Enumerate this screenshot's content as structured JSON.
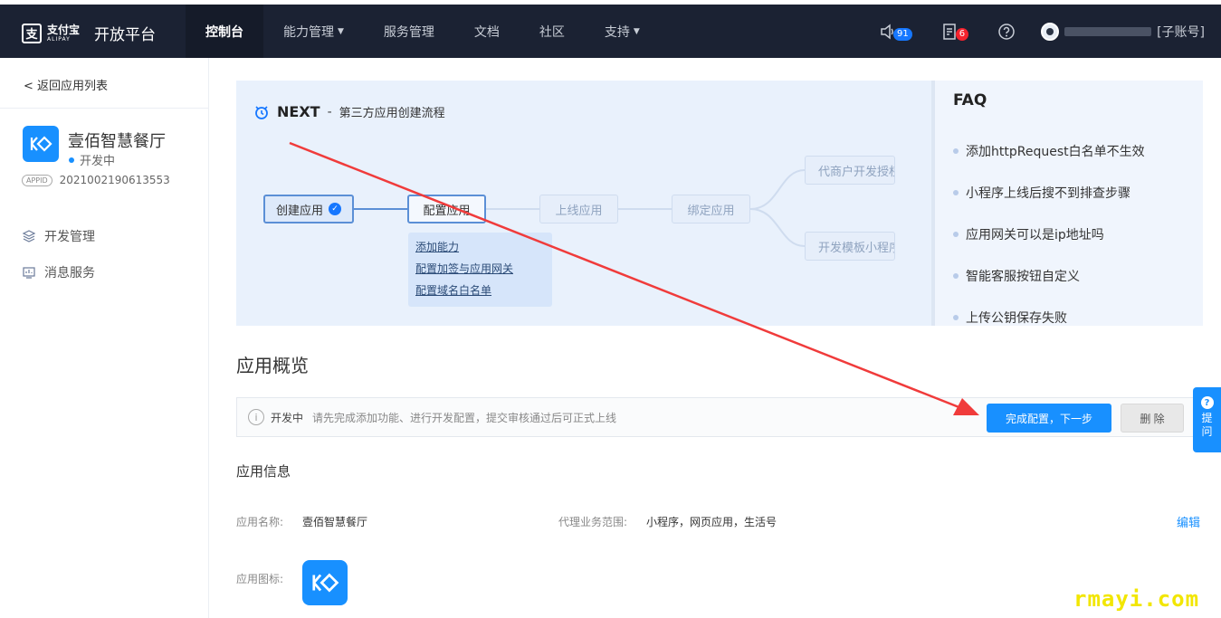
{
  "brand": {
    "logo_cn": "支付宝",
    "logo_en": "ALIPAY",
    "platform": "开放平台"
  },
  "nav": [
    {
      "label": "控制台",
      "active": true,
      "dropdown": false
    },
    {
      "label": "能力管理",
      "active": false,
      "dropdown": true
    },
    {
      "label": "服务管理",
      "active": false,
      "dropdown": false
    },
    {
      "label": "文档",
      "active": false,
      "dropdown": false
    },
    {
      "label": "社区",
      "active": false,
      "dropdown": false
    },
    {
      "label": "支持",
      "active": false,
      "dropdown": true
    }
  ],
  "tools": {
    "notify_count": "91",
    "task_count": "6",
    "user_suffix": "[子账号]"
  },
  "sidebar": {
    "back": "返回应用列表",
    "app_name": "壹佰智慧餐厅",
    "status": "开发中",
    "appid_tag": "APPID",
    "appid": "2021002190613553",
    "menu": [
      "开发管理",
      "消息服务"
    ]
  },
  "flow": {
    "next": "NEXT",
    "sep": "-",
    "subtitle": "第三方应用创建流程",
    "nodes": {
      "create": "创建应用",
      "config": "配置应用",
      "online": "上线应用",
      "bind": "绑定应用",
      "merchant": "代商户开发授权",
      "template": "开发模板小程序"
    },
    "sub_links": [
      "添加能力",
      "配置加签与应用网关",
      "配置域名白名单"
    ]
  },
  "faq": {
    "title": "FAQ",
    "items": [
      "添加httpRequest白名单不生效",
      "小程序上线后搜不到排查步骤",
      "应用网关可以是ip地址吗",
      "智能客服按钮自定义",
      "上传公钥保存失败"
    ]
  },
  "overview": {
    "title": "应用概览",
    "status": "开发中",
    "notice": "请先完成添加功能、进行开发配置，提交审核通过后可正式上线",
    "next_button": "完成配置，下一步",
    "delete_button": "删 除"
  },
  "app_info": {
    "title": "应用信息",
    "name_label": "应用名称:",
    "name_value": "壹佰智慧餐厅",
    "scope_label": "代理业务范围:",
    "scope_value": "小程序，网页应用，生活号",
    "edit": "编辑",
    "icon_label": "应用图标:"
  },
  "help_tab": {
    "q": "?",
    "line1": "提",
    "line2": "问"
  },
  "watermark": "rmayi.com",
  "colors": {
    "topbar": "#1b2233",
    "primary": "#1890ff",
    "banner": "#e9f1fc",
    "arrow": "#f03b3b"
  }
}
